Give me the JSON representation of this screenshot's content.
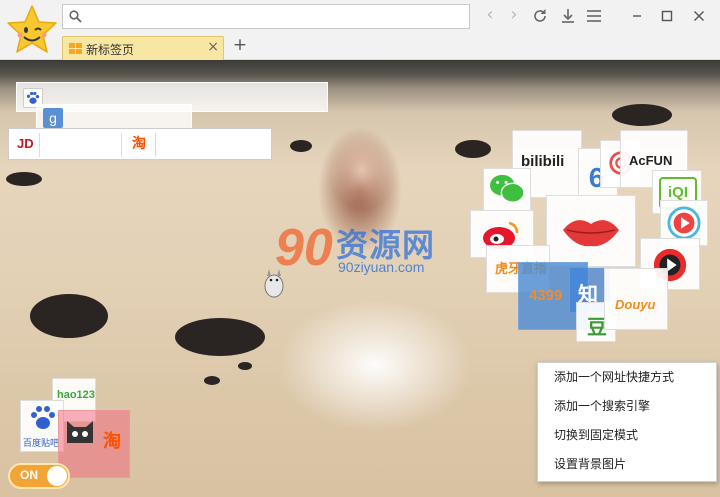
{
  "address_bar": {
    "value": ""
  },
  "tab": {
    "title": "新标签页"
  },
  "new_tab_symbol": "+",
  "close_symbol": "×",
  "search_shortcuts": {
    "jd_label": "JD",
    "taobao_label": "淘"
  },
  "tiles": {
    "bilibili": "bilibili",
    "acfun": "AcFUN",
    "iqiyi": "爱奇艺",
    "huya": "虎牙直播",
    "game4399": "4399",
    "zhihu": "知",
    "douban": "豆",
    "douyu": "Douyu",
    "hao123": "hao123",
    "tieba": "百度贴吧",
    "tmall_taobao": "淘"
  },
  "watermark": {
    "logo": "90",
    "name": "资源网",
    "url": "90ziyuan.com"
  },
  "toggle": {
    "label": "ON",
    "state": "on"
  },
  "context_menu": {
    "items": [
      "添加一个网址快捷方式",
      "添加一个搜索引擎",
      "切换到固定模式",
      "设置背景图片"
    ]
  },
  "colors": {
    "accent": "#f2a536",
    "tab_active": "#f8e6a3",
    "menu_bg": "#ffffff"
  },
  "icons": [
    "star-face-logo",
    "search-icon",
    "back-icon",
    "forward-icon",
    "refresh-icon",
    "download-icon",
    "menu-icon",
    "minimize-icon",
    "maximize-icon",
    "close-icon",
    "apps-grid-icon"
  ]
}
